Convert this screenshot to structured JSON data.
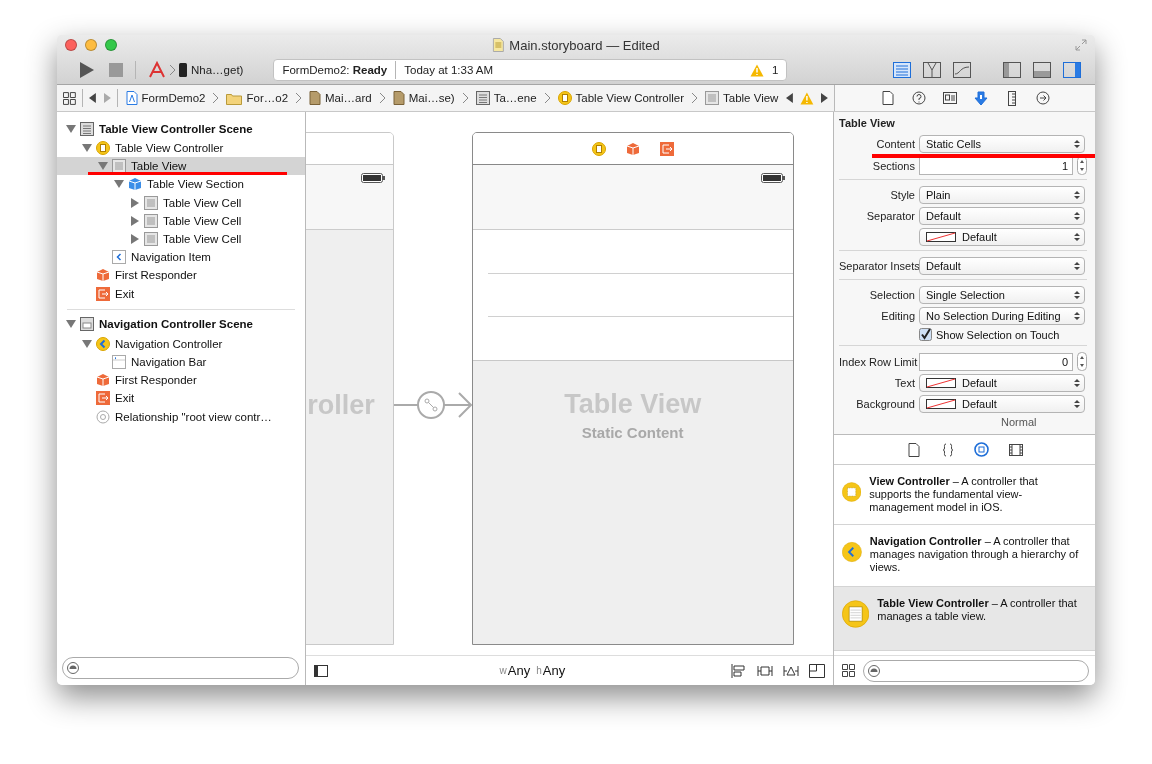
{
  "window": {
    "title": "Main.storyboard — Edited"
  },
  "toolbar": {
    "scheme": "Nha…get)",
    "status": "FormDemo2: **Ready**",
    "time": "Today at 1:33 AM",
    "warnings": "1",
    "editor_modes": [
      {
        "kind": "standard",
        "selected": true
      },
      {
        "kind": "assistant",
        "selected": false
      },
      {
        "kind": "version",
        "selected": false
      }
    ],
    "panels": [
      {
        "kind": "navigator",
        "selected": false
      },
      {
        "kind": "debug",
        "selected": false
      },
      {
        "kind": "utilities",
        "selected": true
      }
    ]
  },
  "jump_bar": {
    "items": [
      {
        "kind": "project",
        "label": "FormDemo2"
      },
      {
        "kind": "folder",
        "label": "For…o2"
      },
      {
        "kind": "storyboard",
        "label": "Mai…ard"
      },
      {
        "kind": "storyboard",
        "label": "Mai…se)"
      },
      {
        "kind": "scene",
        "label": "Ta…ene"
      },
      {
        "kind": "controller",
        "label": "Table View Controller"
      },
      {
        "kind": "table",
        "label": "Table View"
      }
    ]
  },
  "inspector_tabs": [
    {
      "kind": "file",
      "selected": false
    },
    {
      "kind": "help",
      "selected": false
    },
    {
      "kind": "identity",
      "selected": false
    },
    {
      "kind": "attributes",
      "selected": true
    },
    {
      "kind": "size",
      "selected": false
    },
    {
      "kind": "connections",
      "selected": false
    }
  ],
  "outline": [
    {
      "kind": "scene",
      "label": "Table View Controller Scene",
      "expanded": true,
      "selected": false,
      "children": [
        {
          "kind": "table-controller",
          "label": "Table View Controller",
          "expanded": true,
          "selected": false,
          "children": [
            {
              "kind": "table",
              "label": "Table View",
              "expanded": true,
              "selected": true,
              "children": [
                {
                  "kind": "section",
                  "label": "Table View Section",
                  "expanded": true,
                  "selected": false,
                  "children": [
                    {
                      "kind": "cell",
                      "label": "Table View Cell",
                      "expanded": false,
                      "selected": false
                    },
                    {
                      "kind": "cell",
                      "label": "Table View Cell",
                      "expanded": false,
                      "selected": false
                    },
                    {
                      "kind": "cell",
                      "label": "Table View Cell",
                      "expanded": false,
                      "selected": false
                    }
                  ]
                }
              ]
            },
            {
              "kind": "nav-item",
              "label": "Navigation Item",
              "selected": false
            }
          ]
        },
        {
          "kind": "responder",
          "label": "First Responder",
          "selected": false
        },
        {
          "kind": "exit",
          "label": "Exit",
          "selected": false
        }
      ]
    },
    {
      "kind": "nav-scene",
      "label": "Navigation Controller Scene",
      "expanded": true,
      "selected": false,
      "children": [
        {
          "kind": "nav-controller",
          "label": "Navigation Controller",
          "expanded": true,
          "selected": false,
          "children": [
            {
              "kind": "nav-bar",
              "label": "Navigation Bar",
              "selected": false
            }
          ]
        },
        {
          "kind": "responder",
          "label": "First Responder",
          "selected": false
        },
        {
          "kind": "exit",
          "label": "Exit",
          "selected": false
        },
        {
          "kind": "relationship",
          "label": "Relationship \"root view contr…",
          "selected": false
        }
      ]
    }
  ],
  "canvas": {
    "partial_scene_label": "roller",
    "table_scene": {
      "title": "Table View",
      "subtitle": "Static Content"
    },
    "size_class": [
      {
        "prefix": "w",
        "value": "Any"
      },
      {
        "prefix": "h",
        "value": "Any"
      }
    ]
  },
  "inspector": {
    "title": "Table View",
    "groups": [
      {
        "fields": [
          {
            "kind": "select",
            "label": "Content",
            "value": "Static Cells"
          },
          {
            "kind": "stepper",
            "label": "Sections",
            "value": "1"
          }
        ]
      },
      {
        "fields": [
          {
            "kind": "select",
            "label": "Style",
            "value": "Plain"
          },
          {
            "kind": "select",
            "label": "Separator",
            "value": "Default"
          },
          {
            "kind": "color",
            "value": "Default"
          }
        ]
      },
      {
        "fields": [
          {
            "kind": "select",
            "label": "Separator Insets",
            "value": "Default"
          }
        ]
      },
      {
        "fields": [
          {
            "kind": "select",
            "label": "Selection",
            "value": "Single Selection"
          },
          {
            "kind": "select",
            "label": "Editing",
            "value": "No Selection During Editing"
          },
          {
            "kind": "checkbox",
            "value": "Show Selection on Touch",
            "checked": true
          }
        ]
      },
      {
        "fields": [
          {
            "kind": "stepper",
            "label": "Index Row Limit",
            "value": "0"
          },
          {
            "kind": "color",
            "label": "Text",
            "value": "Default"
          },
          {
            "kind": "color",
            "label": "Background",
            "value": "Default"
          },
          {
            "kind": "caption",
            "value": "Normal"
          }
        ]
      }
    ]
  },
  "library": {
    "tabs": [
      {
        "kind": "file",
        "selected": false
      },
      {
        "kind": "code",
        "selected": false
      },
      {
        "kind": "object",
        "selected": true
      },
      {
        "kind": "media",
        "selected": false
      }
    ],
    "items": [
      {
        "kind": "view-controller",
        "text": "**View Controller** – A controller that supports the fundamental view-management model in iOS.",
        "selected": false
      },
      {
        "kind": "nav-controller",
        "text": "**Navigation Controller** – A controller that manages navigation through a hierarchy of views.",
        "selected": false
      },
      {
        "kind": "table-controller",
        "text": "**Table View Controller** – A controller that manages a table view.",
        "selected": true
      }
    ]
  }
}
